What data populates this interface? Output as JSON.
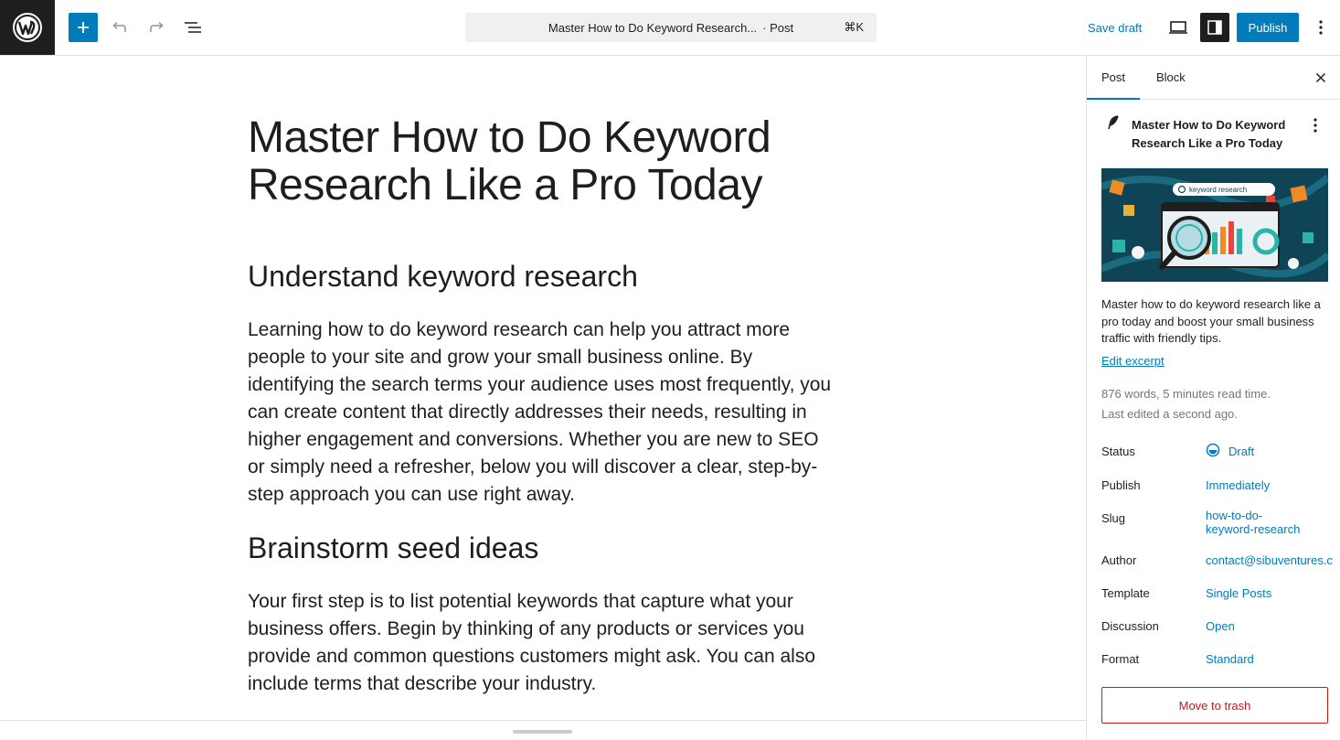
{
  "toolbar": {
    "command_title": "Master How to Do Keyword Research...",
    "command_type": "· Post",
    "command_shortcut": "⌘K",
    "save_draft_label": "Save draft",
    "publish_label": "Publish"
  },
  "post": {
    "title": "Master How to Do Keyword Research Like a Pro Today",
    "sections": [
      {
        "heading": "Understand keyword research",
        "paragraph": "Learning how to do keyword research can help you attract more people to your site and grow your small business online. By identifying the search terms your audience uses most frequently, you can create content that directly addresses their needs, resulting in higher engagement and conversions. Whether you are new to SEO or simply need a refresher, below you will discover a clear, step-by-step approach you can use right away."
      },
      {
        "heading": "Brainstorm seed ideas",
        "paragraph": "Your first step is to list potential keywords that capture what your business offers. Begin by thinking of any products or services you provide and common questions customers might ask. You can also include terms that describe your industry."
      }
    ]
  },
  "sidebar": {
    "tabs": [
      "Post",
      "Block"
    ],
    "post_title": "Master How to Do Keyword Research Like a Pro Today",
    "image_text": "keyword research",
    "excerpt": "Master how to do keyword research like a pro today and boost your small business traffic with friendly tips.",
    "edit_excerpt_label": "Edit excerpt",
    "word_count": "876 words, 5 minutes read time.",
    "last_edited": "Last edited a second ago.",
    "rows": [
      {
        "label": "Status",
        "value": "Draft"
      },
      {
        "label": "Publish",
        "value": "Immediately"
      },
      {
        "label": "Slug",
        "value": "how-to-do-",
        "value2": "keyword-research"
      },
      {
        "label": "Author",
        "value": "contact@sibuventures.c"
      },
      {
        "label": "Template",
        "value": "Single Posts"
      },
      {
        "label": "Discussion",
        "value": "Open"
      },
      {
        "label": "Format",
        "value": "Standard"
      }
    ],
    "trash_label": "Move to trash"
  },
  "colors": {
    "accent": "#007cba",
    "danger": "#cc1818",
    "dark": "#1e1e1e"
  }
}
